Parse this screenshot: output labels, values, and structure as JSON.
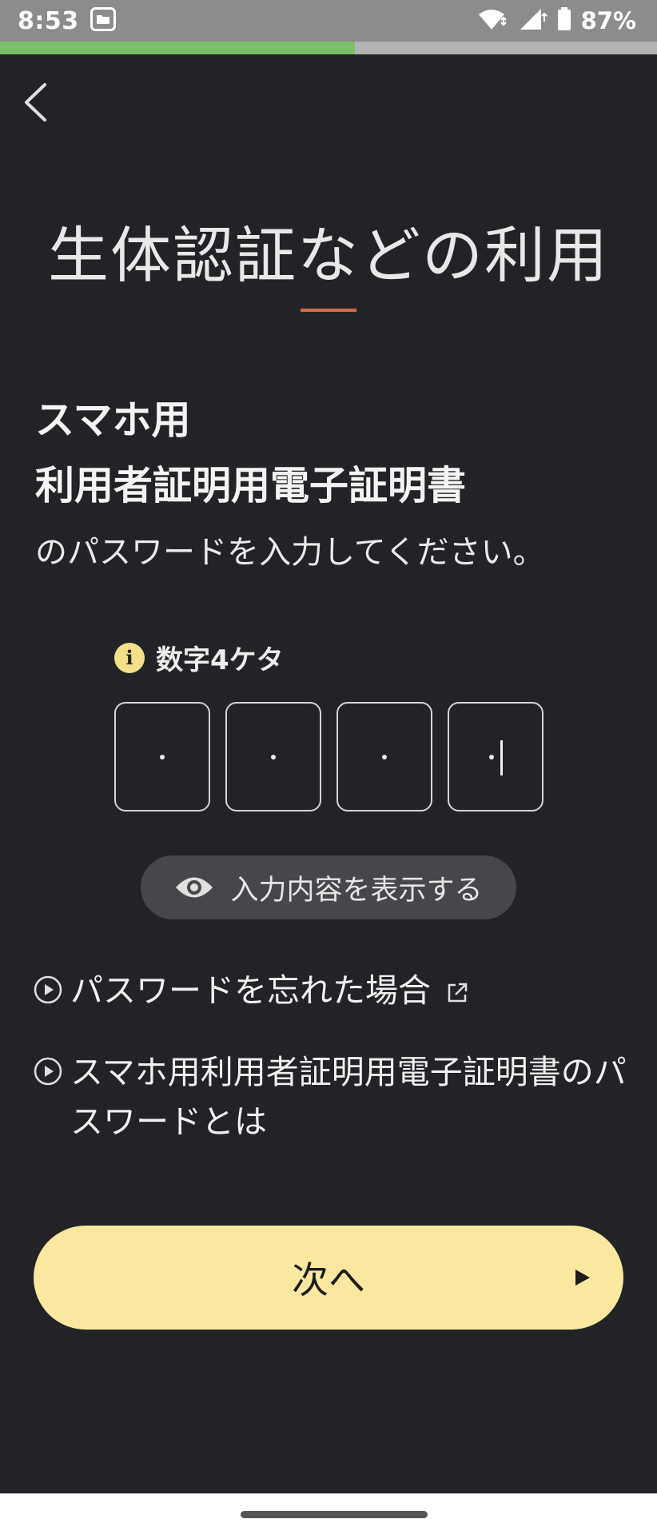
{
  "status_bar": {
    "time": "8:53",
    "battery": "87%",
    "icons": [
      "folder-notification-icon",
      "wifi-icon",
      "signal-icon",
      "battery-icon"
    ]
  },
  "progress": {
    "fraction": 0.54,
    "color": "#7bbf6a"
  },
  "header": {
    "back_icon": "chevron-left-icon"
  },
  "page": {
    "title": "生体認証などの利用",
    "accent_color": "#d86a45"
  },
  "prompt": {
    "line1": "スマホ用",
    "line2": "利用者証明用電子証明書",
    "line3": "のパスワードを入力してください。"
  },
  "pin": {
    "hint": "数字4ケタ",
    "hint_icon": "info-icon",
    "digits": [
      "・",
      "・",
      "・",
      "・"
    ],
    "filled_count": 4
  },
  "show_toggle": {
    "label": "入力内容を表示する",
    "icon": "eye-icon"
  },
  "links": [
    {
      "label": "パスワードを忘れた場合",
      "icon": "play-circle-icon",
      "external": true
    },
    {
      "label": "スマホ用利用者証明用電子証明書のパスワードとは",
      "icon": "play-circle-icon",
      "external": false
    }
  ],
  "next_button": {
    "label": "次へ",
    "icon": "play-arrow-icon",
    "color": "#fbe8a0"
  }
}
